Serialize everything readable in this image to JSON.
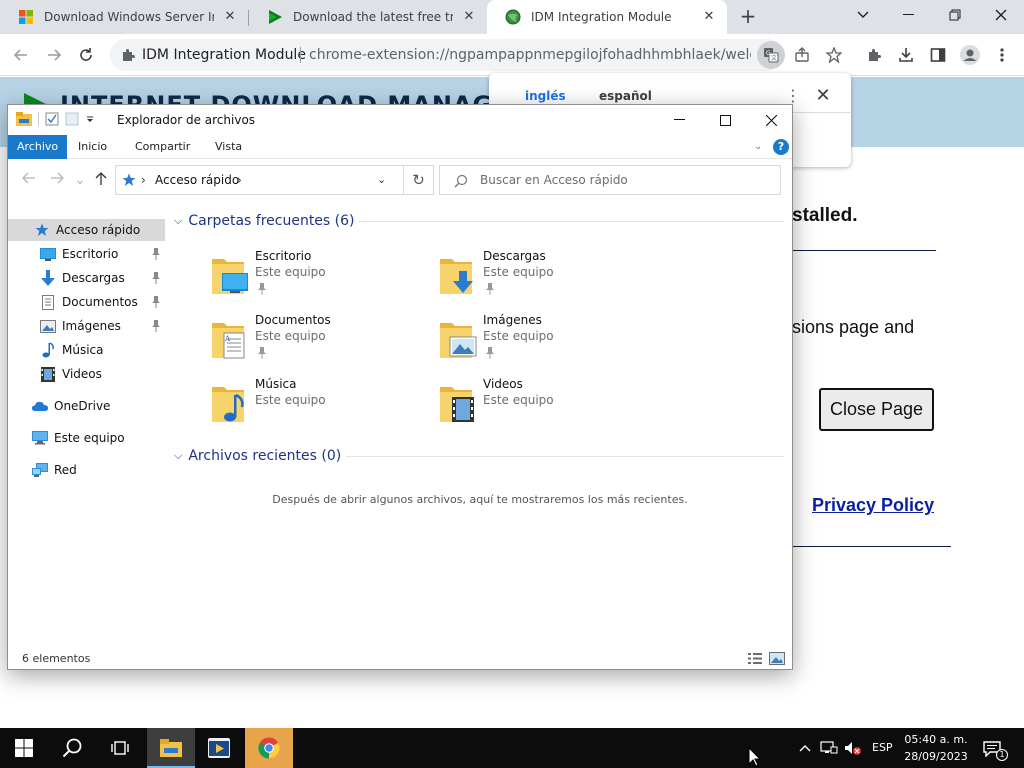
{
  "browser": {
    "tabs": [
      {
        "title": "Download Windows Server Insid",
        "favicon": "windows-logo-icon",
        "active": false
      },
      {
        "title": "Download the latest free trial ve",
        "favicon": "idm-play-icon",
        "active": false
      },
      {
        "title": "IDM Integration Module",
        "favicon": "idm-globe-icon",
        "active": true
      }
    ],
    "omnibox": {
      "site_name": "IDM Integration Module",
      "url": "chrome-extension://ngpampappnmepgilojfohadhhmbhlaek/welcome...."
    }
  },
  "translate_popup": {
    "source_lang": "inglés",
    "target_lang": "español"
  },
  "webpage": {
    "brand_title": "INTERNET DOWNLOAD MANAGER",
    "installed_text": "stalled.",
    "extensions_text": "sions page and",
    "close_button": "Close Page",
    "privacy_link": "Privacy Policy"
  },
  "explorer": {
    "title": "Explorador de archivos",
    "ribbon_tabs": [
      "Archivo",
      "Inicio",
      "Compartir",
      "Vista"
    ],
    "address": "Acceso rápido",
    "search_placeholder": "Buscar en Acceso rápido",
    "nav_items": [
      {
        "label": "Acceso rápido",
        "icon": "star-icon",
        "pinned": false,
        "selected": true
      },
      {
        "label": "Escritorio",
        "icon": "desktop-icon",
        "pinned": true
      },
      {
        "label": "Descargas",
        "icon": "downloads-icon",
        "pinned": true
      },
      {
        "label": "Documentos",
        "icon": "documents-icon",
        "pinned": true
      },
      {
        "label": "Imágenes",
        "icon": "pictures-icon",
        "pinned": true
      },
      {
        "label": "Música",
        "icon": "music-icon",
        "pinned": false
      },
      {
        "label": "Videos",
        "icon": "videos-icon",
        "pinned": false
      },
      {
        "label": "OneDrive",
        "icon": "onedrive-icon",
        "pinned": false
      },
      {
        "label": "Este equipo",
        "icon": "this-pc-icon",
        "pinned": false
      },
      {
        "label": "Red",
        "icon": "network-icon",
        "pinned": false
      }
    ],
    "frequent_header": "Carpetas frecuentes (6)",
    "folders": [
      {
        "name": "Escritorio",
        "location": "Este equipo",
        "pinned": true,
        "icon": "desktop-folder-icon"
      },
      {
        "name": "Descargas",
        "location": "Este equipo",
        "pinned": true,
        "icon": "downloads-folder-icon"
      },
      {
        "name": "Documentos",
        "location": "Este equipo",
        "pinned": true,
        "icon": "documents-folder-icon"
      },
      {
        "name": "Imágenes",
        "location": "Este equipo",
        "pinned": true,
        "icon": "pictures-folder-icon"
      },
      {
        "name": "Música",
        "location": "Este equipo",
        "pinned": false,
        "icon": "music-folder-icon"
      },
      {
        "name": "Videos",
        "location": "Este equipo",
        "pinned": false,
        "icon": "videos-folder-icon"
      }
    ],
    "recent_header": "Archivos recientes (0)",
    "recent_empty_message": "Después de abrir algunos archivos, aquí te mostraremos los más recientes.",
    "status": "6 elementos"
  },
  "taskbar": {
    "language": "ESP",
    "time": "05:40 a. m.",
    "date": "28/09/2023",
    "notification_count": "1"
  },
  "colors": {
    "chrome_tabstrip": "#dee1e6",
    "explorer_accent": "#1979ca",
    "section_header": "#1e3287",
    "idm_header": "#b7d3e6",
    "taskbar": "#0c0c0c"
  }
}
